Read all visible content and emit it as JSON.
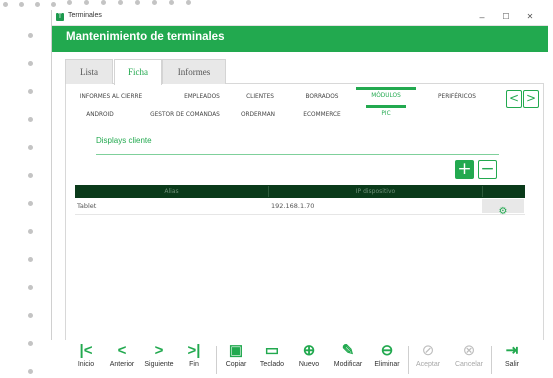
{
  "window": {
    "title": "Terminales",
    "controls": [
      "–",
      "☐",
      "✕"
    ]
  },
  "header": {
    "title": "Mantenimiento de terminales"
  },
  "main_tabs": [
    {
      "label": "Lista"
    },
    {
      "label": "Ficha"
    },
    {
      "label": "Informes"
    }
  ],
  "sub_tabs_row1": [
    {
      "label": "INFORMES AL CIERRE"
    },
    {
      "label": "EMPLEADOS"
    },
    {
      "label": "CLIENTES"
    },
    {
      "label": "BORRADOS"
    },
    {
      "label": "MÓDULOS"
    },
    {
      "label": "PERIFÉRICOS"
    }
  ],
  "sub_tabs_row2": [
    {
      "label": "ANDROID"
    },
    {
      "label": "GESTOR DE COMANDAS"
    },
    {
      "label": "ORDERMAN"
    },
    {
      "label": "ECOMMERCE"
    },
    {
      "label": "PIC"
    }
  ],
  "nav": {
    "prev": "<",
    "next": ">"
  },
  "section": {
    "title": "Displays cliente"
  },
  "actions": {
    "add": "+",
    "remove": "−"
  },
  "table": {
    "columns": [
      "Alias",
      "IP dispositivo"
    ],
    "rows": [
      {
        "alias": "Tablet",
        "ip": "192.168.1.70"
      }
    ]
  },
  "toolbar": [
    {
      "label": "Inicio",
      "icon": "first-icon",
      "glyph": "|<"
    },
    {
      "label": "Anterior",
      "icon": "prev-icon",
      "glyph": "<"
    },
    {
      "label": "Siguiente",
      "icon": "next-icon",
      "glyph": ">"
    },
    {
      "label": "Fin",
      "icon": "last-icon",
      "glyph": ">|"
    },
    {
      "label": "Copiar",
      "icon": "copy-icon",
      "glyph": "▣"
    },
    {
      "label": "Teclado",
      "icon": "keyboard-icon",
      "glyph": "▭"
    },
    {
      "label": "Nuevo",
      "icon": "new-icon",
      "glyph": "⊕"
    },
    {
      "label": "Modificar",
      "icon": "edit-icon",
      "glyph": "✎"
    },
    {
      "label": "Eliminar",
      "icon": "delete-icon",
      "glyph": "⊖"
    },
    {
      "label": "Aceptar",
      "icon": "accept-icon",
      "glyph": "⊘"
    },
    {
      "label": "Cancelar",
      "icon": "cancel-icon",
      "glyph": "⊗"
    },
    {
      "label": "Salir",
      "icon": "exit-icon",
      "glyph": "⇥"
    }
  ],
  "colors": {
    "accent": "#22a94f",
    "table_header": "#0a3a1a",
    "disabled": "#bdbdbd"
  }
}
